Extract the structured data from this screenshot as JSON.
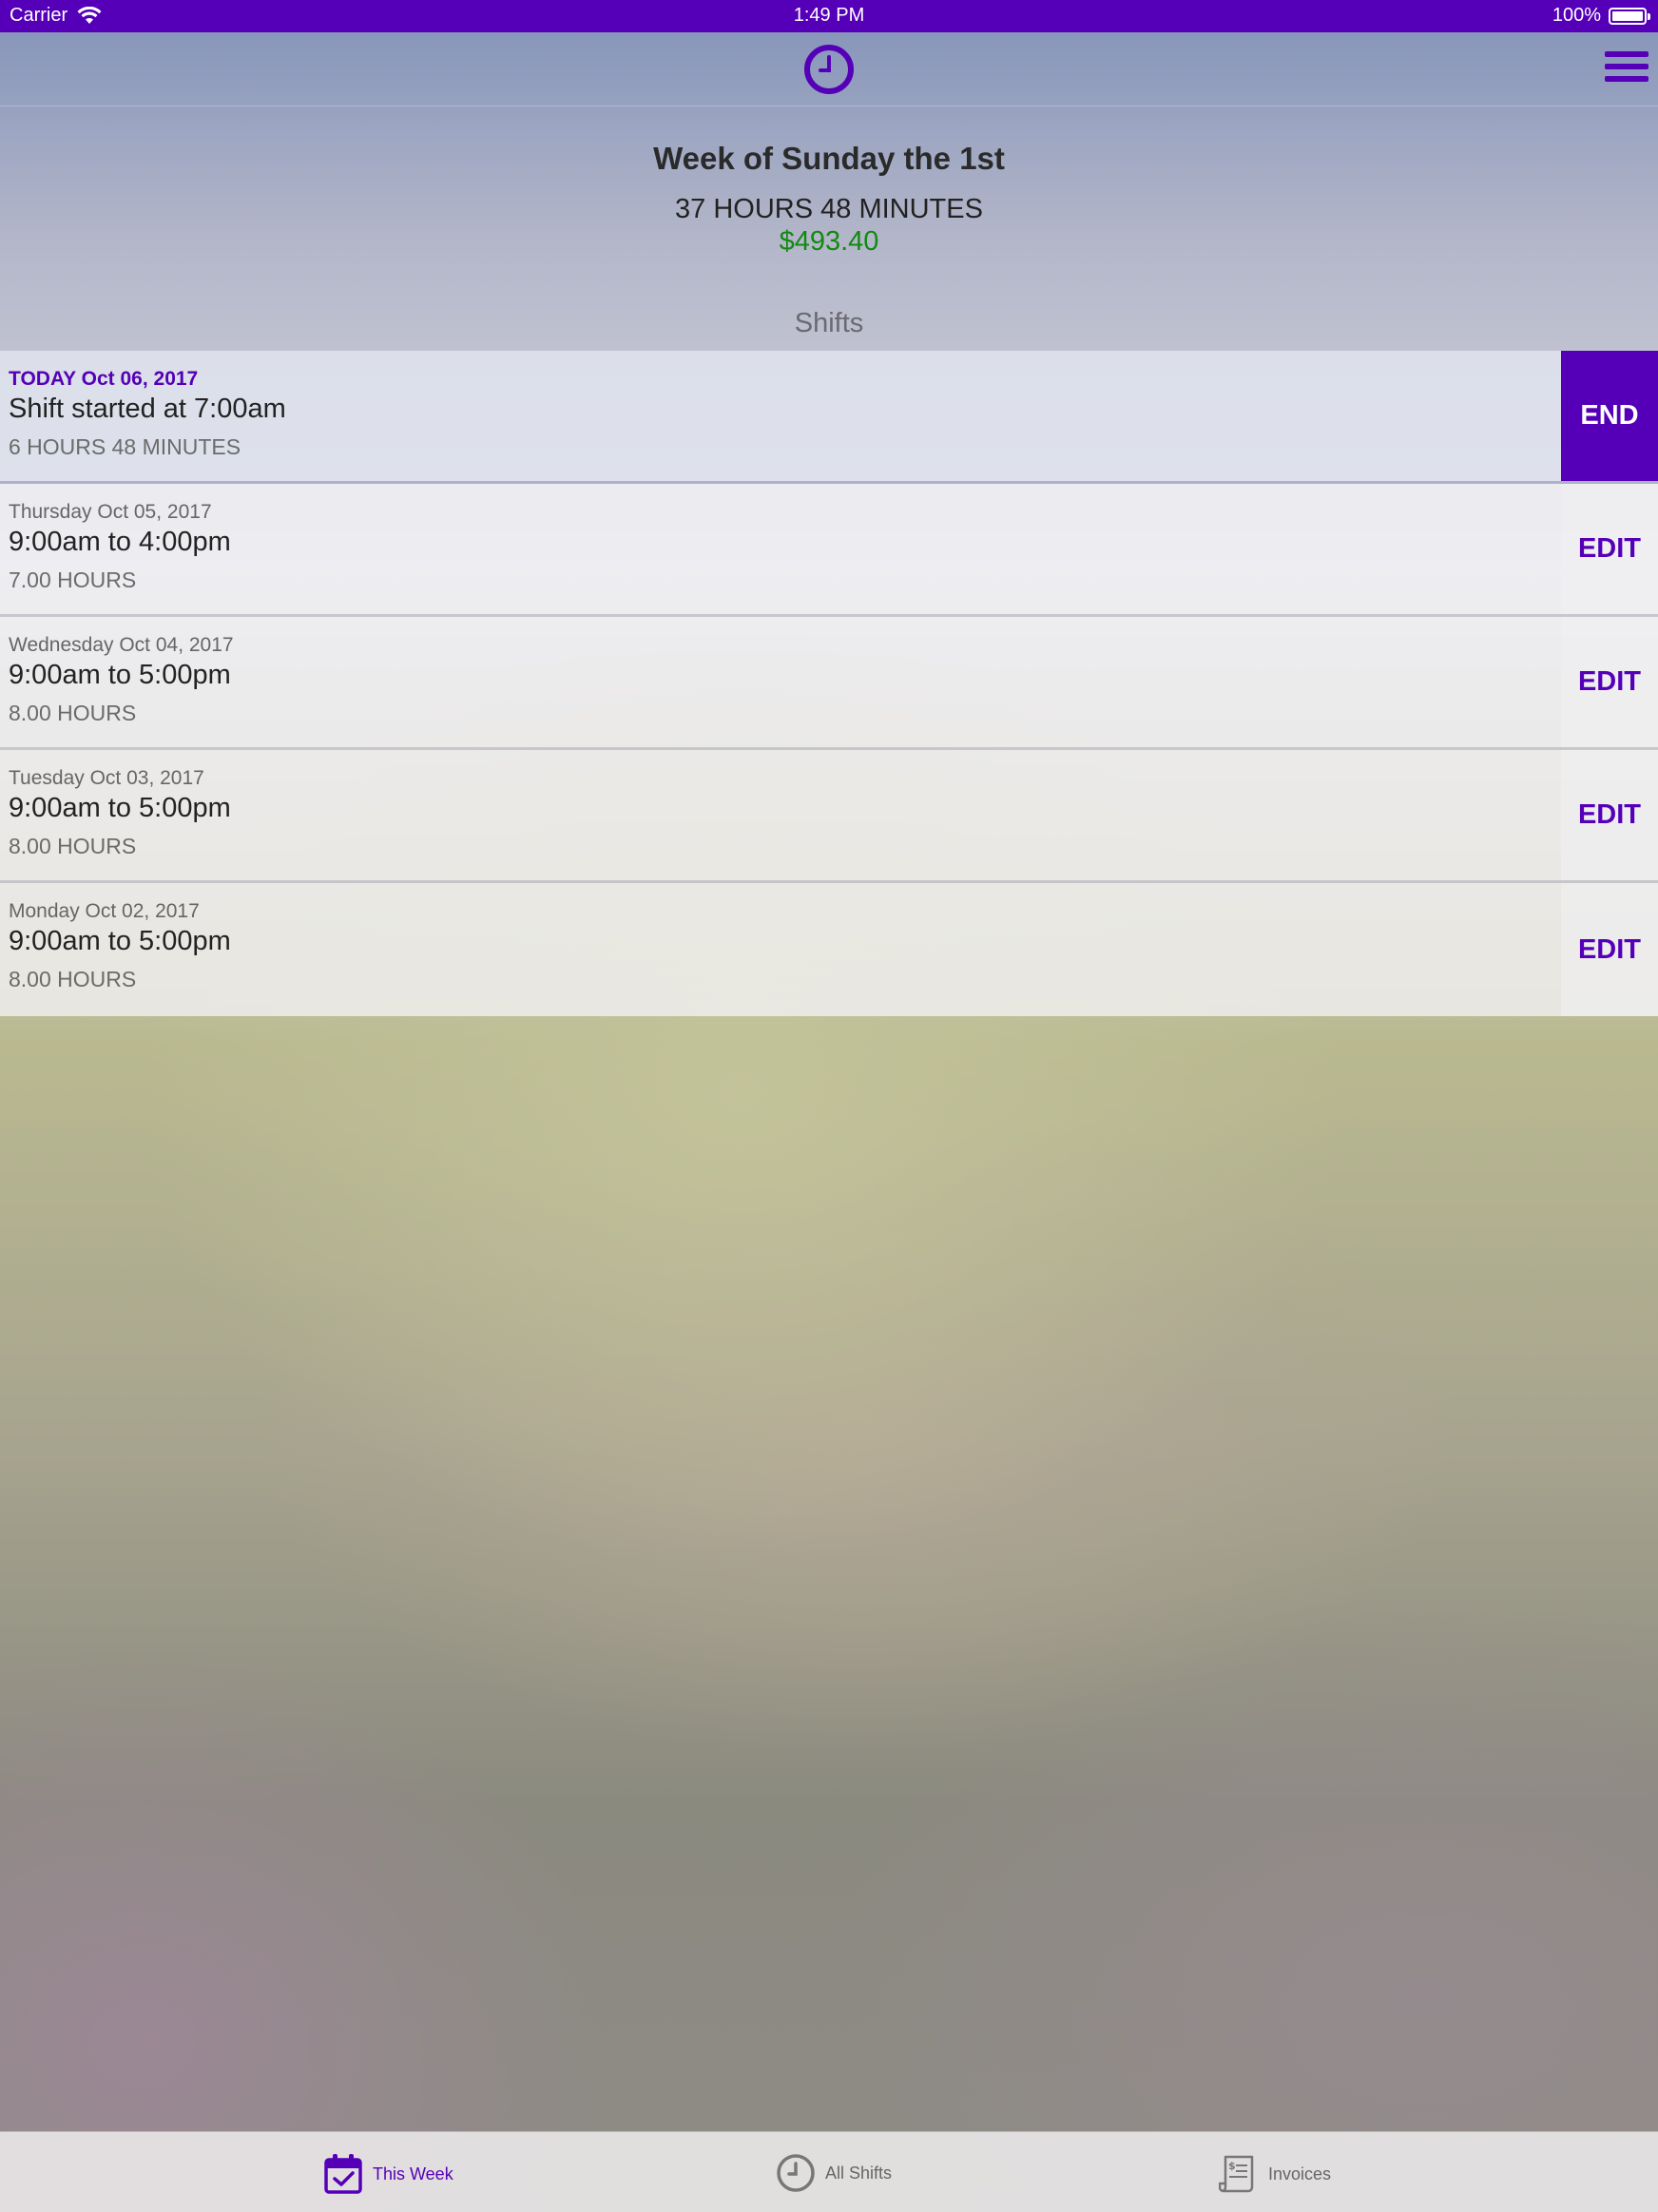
{
  "status_bar": {
    "carrier": "Carrier",
    "time": "1:49 PM",
    "battery": "100%"
  },
  "nav": {
    "logo_icon": "clock-icon",
    "menu_icon": "hamburger-menu-icon"
  },
  "summary": {
    "week_title": "Week of Sunday the 1st",
    "total_hours": "37 HOURS 48 MINUTES",
    "total_pay": "$493.40",
    "section_header": "Shifts"
  },
  "shifts": [
    {
      "date": "TODAY Oct 06, 2017",
      "range": "Shift started at 7:00am",
      "duration": "6 HOURS 48 MINUTES",
      "action": "END"
    },
    {
      "date": "Thursday Oct 05, 2017",
      "range": "9:00am to 4:00pm",
      "duration": "7.00 HOURS",
      "action": "EDIT"
    },
    {
      "date": "Wednesday Oct 04, 2017",
      "range": "9:00am to 5:00pm",
      "duration": "8.00 HOURS",
      "action": "EDIT"
    },
    {
      "date": "Tuesday Oct 03, 2017",
      "range": "9:00am to 5:00pm",
      "duration": "8.00 HOURS",
      "action": "EDIT"
    },
    {
      "date": "Monday Oct 02, 2017",
      "range": "9:00am to 5:00pm",
      "duration": "8.00 HOURS",
      "action": "EDIT"
    }
  ],
  "tabs": [
    {
      "label": "This Week",
      "icon": "calendar-check-icon",
      "active": true
    },
    {
      "label": "All Shifts",
      "icon": "clock-icon",
      "active": false
    },
    {
      "label": "Invoices",
      "icon": "invoice-icon",
      "active": false
    }
  ],
  "colors": {
    "accent": "#5500b8",
    "money": "#118a11"
  }
}
